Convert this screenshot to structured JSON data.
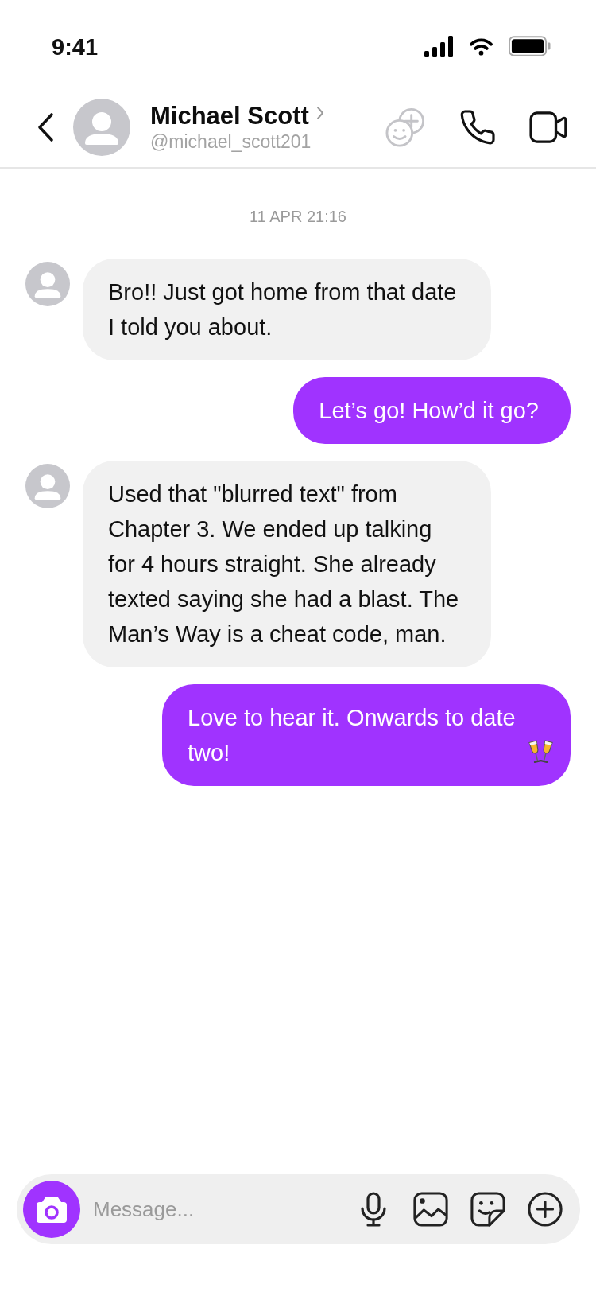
{
  "status_bar": {
    "time": "9:41"
  },
  "header": {
    "name": "Michael Scott",
    "handle": "@michael_scott201"
  },
  "conversation": {
    "timestamp": "11 APR 21:16",
    "messages": [
      {
        "kind": "incoming",
        "text": "Bro!! Just got home from that date I told you about."
      },
      {
        "kind": "outgoing",
        "text": "Let’s go! How’d it go?"
      },
      {
        "kind": "incoming",
        "text": "Used that \"blurred text\" from Chapter 3. We ended up talking for 4 hours straight. She already texted saying she had a blast. The Man’s Way is a cheat code, man."
      },
      {
        "kind": "outgoing",
        "text": "Love to hear it. Onwards to date two!",
        "trailing_emoji": true
      }
    ]
  },
  "composer": {
    "placeholder": "Message..."
  }
}
